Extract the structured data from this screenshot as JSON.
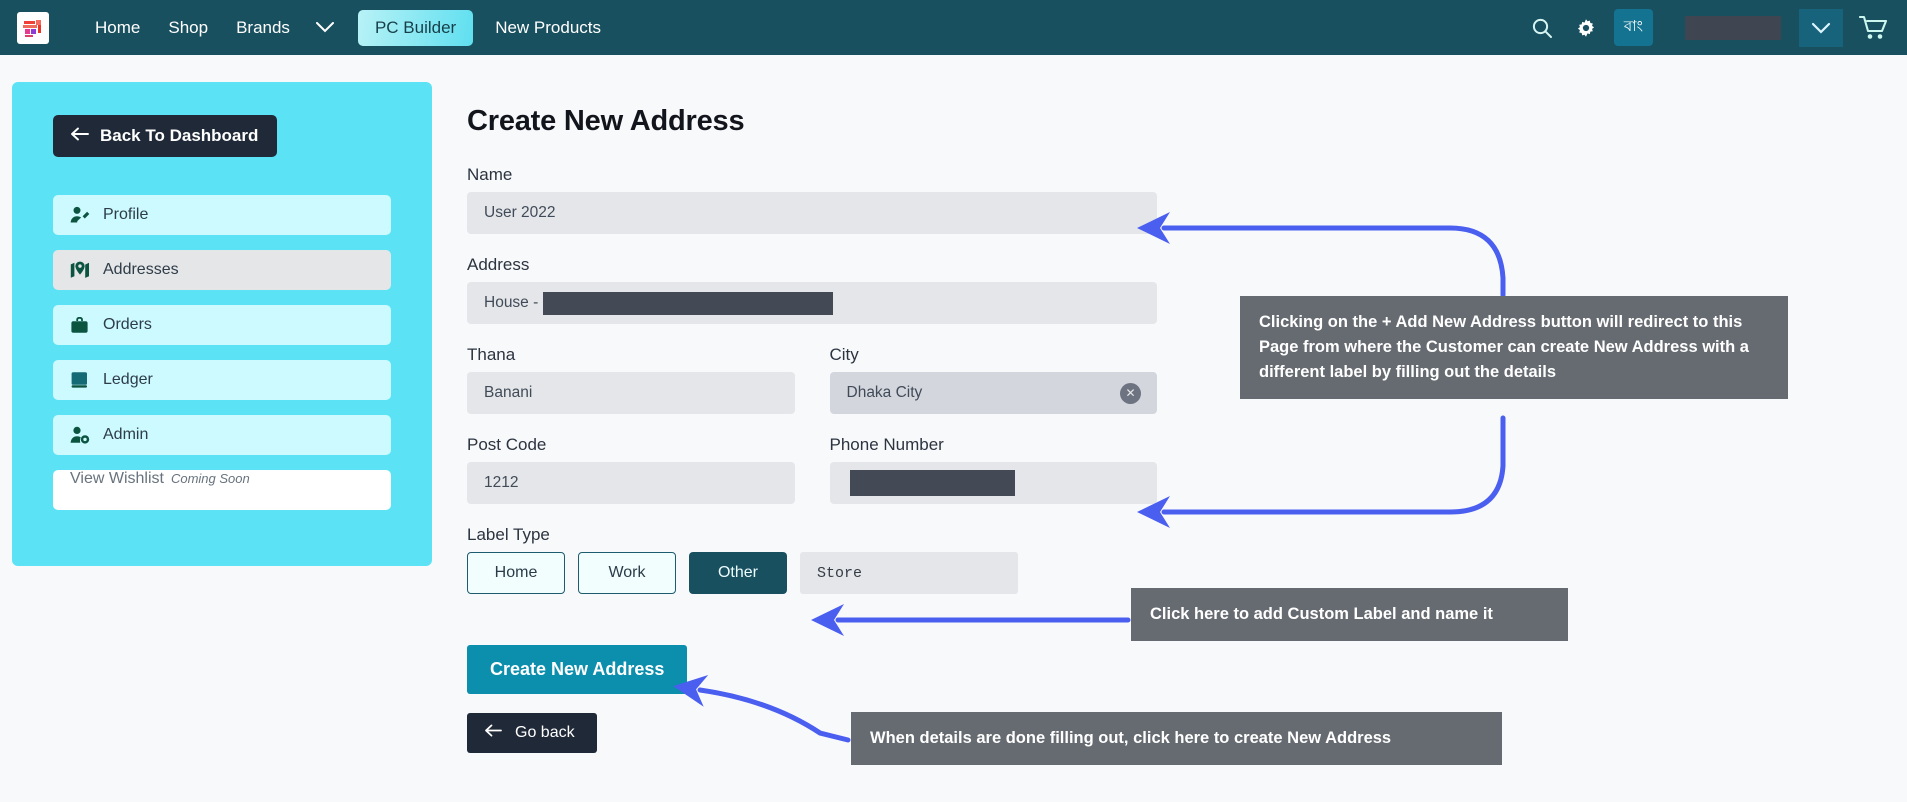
{
  "navbar": {
    "logo_icon": "site-logo",
    "links": [
      {
        "label": "Home"
      },
      {
        "label": "Shop"
      },
      {
        "label": "Brands"
      }
    ],
    "brands_caret_icon": "chevron-down-icon",
    "pc_builder_label": "PC Builder",
    "new_products_label": "New Products",
    "search_icon": "search-icon",
    "settings_icon": "gear-icon",
    "language_label": "বাং",
    "user_name": "",
    "user_caret_icon": "chevron-down-icon",
    "cart_icon": "shopping-cart-icon",
    "bg_color": "#19505f",
    "pc_builder_accent": "#5fdff0"
  },
  "sidebar": {
    "bg_color": "#5ce2f5",
    "back_label": "Back To Dashboard",
    "back_icon": "arrow-left-icon",
    "items": [
      {
        "label": "Profile",
        "icon": "user-edit-icon",
        "active": false
      },
      {
        "label": "Addresses",
        "icon": "map-marker-icon",
        "active": true
      },
      {
        "label": "Orders",
        "icon": "briefcase-icon",
        "active": false
      },
      {
        "label": "Ledger",
        "icon": "book-icon",
        "active": false
      },
      {
        "label": "Admin",
        "icon": "user-gear-icon",
        "active": false
      }
    ],
    "wishlist": {
      "label": "View Wishlist",
      "badge": "Coming Soon"
    }
  },
  "main": {
    "title": "Create New Address",
    "fields": {
      "name": {
        "label": "Name",
        "value": "User 2022"
      },
      "address": {
        "label": "Address",
        "value": "House -",
        "redacted": true
      },
      "thana": {
        "label": "Thana",
        "value": "Banani"
      },
      "city": {
        "label": "City",
        "value": "Dhaka City",
        "clear_icon": "clear-x-icon"
      },
      "postcode": {
        "label": "Post Code",
        "value": "1212"
      },
      "phone": {
        "label": "Phone Number",
        "value": "",
        "redacted": true
      }
    },
    "label_type": {
      "label": "Label Type",
      "options": [
        {
          "label": "Home",
          "selected": false
        },
        {
          "label": "Work",
          "selected": false
        },
        {
          "label": "Other",
          "selected": true
        }
      ],
      "custom_value": "Store",
      "custom_placeholder": "Store"
    },
    "create_button": {
      "label": "Create New Address",
      "color": "#0c8ead"
    },
    "go_back_button": {
      "label": "Go back",
      "icon": "arrow-left-icon"
    }
  },
  "annotations": {
    "arrow_color": "#4a5ef0",
    "box_color": "#666b71",
    "items": [
      {
        "id": "anno1",
        "text": "Clicking on the + Add New Address button will redirect to this Page from where the Customer can create New Address with a different label by filling out the details"
      },
      {
        "id": "anno2",
        "text": "Click here to add Custom Label and name it"
      },
      {
        "id": "anno3",
        "text": "When details are done filling out, click here to create New Address"
      }
    ]
  }
}
